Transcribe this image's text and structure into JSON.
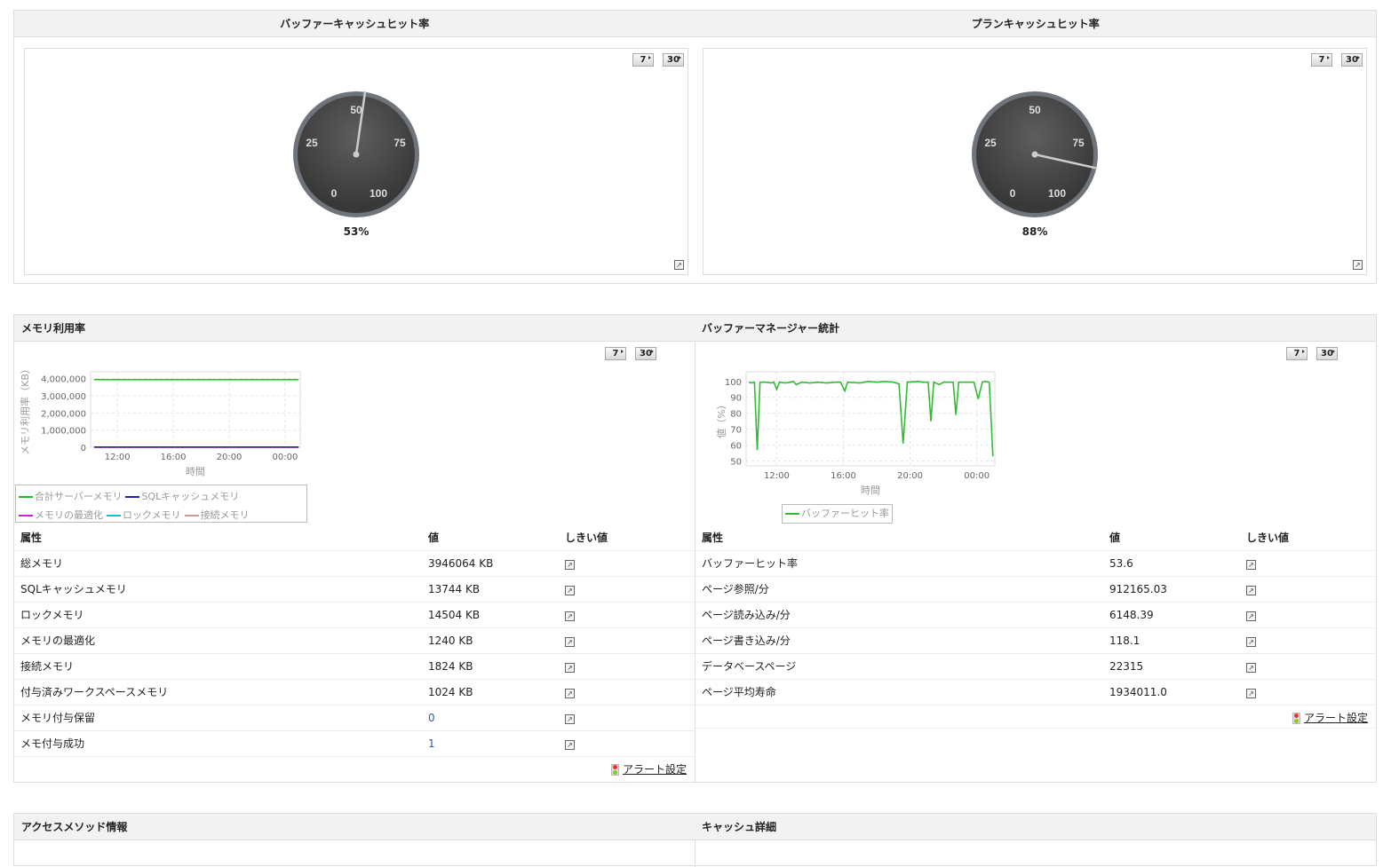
{
  "top_panel": {
    "gauges": [
      {
        "title": "バッファーキャッシュヒット率",
        "value": 53,
        "value_label": "53%",
        "ticks": [
          "0",
          "25",
          "50",
          "75",
          "100"
        ],
        "btn7": "7",
        "btn30": "30"
      },
      {
        "title": "プランキャッシュヒット率",
        "value": 88,
        "value_label": "88%",
        "ticks": [
          "0",
          "25",
          "50",
          "75",
          "100"
        ],
        "btn7": "7",
        "btn30": "30"
      }
    ]
  },
  "memory": {
    "title": "メモリ利用率",
    "btn7": "7",
    "btn30": "30",
    "chart_data": {
      "type": "line",
      "xlabel": "時間",
      "ylabel": "メモリ利用率（KB）",
      "ylim": [
        0,
        4400000
      ],
      "xticks": [
        "12:00",
        "16:00",
        "20:00",
        "00:00"
      ],
      "yticks": [
        "0",
        "1,000,000",
        "2,000,000",
        "3,000,000",
        "4,000,000"
      ],
      "x": [
        "10:20",
        "00:58"
      ],
      "series": [
        {
          "name": "合計サーバーメモリ",
          "color": "#22bb22",
          "values": [
            3946064,
            3946064
          ]
        },
        {
          "name": "SQLキャッシュメモリ",
          "color": "#2222aa",
          "values": [
            13744,
            13744
          ]
        },
        {
          "name": "メモリの最適化",
          "color": "#cc22cc",
          "values": [
            1240,
            1240
          ]
        },
        {
          "name": "ロックメモリ",
          "color": "#22bbcc",
          "values": [
            14504,
            14504
          ]
        },
        {
          "name": "接続メモリ",
          "color": "#cc9999",
          "values": [
            1824,
            1824
          ]
        }
      ]
    },
    "table": {
      "headers": [
        "属性",
        "値",
        "しきい値"
      ],
      "rows": [
        [
          "総メモリ",
          "3946064 KB"
        ],
        [
          "SQLキャッシュメモリ",
          "13744 KB"
        ],
        [
          "ロックメモリ",
          "14504 KB"
        ],
        [
          "メモリの最適化",
          "1240 KB"
        ],
        [
          "接続メモリ",
          "1824 KB"
        ],
        [
          "付与済みワークスペースメモリ",
          "1024 KB"
        ],
        [
          "メモリ付与保留",
          "0"
        ],
        [
          "メモ付与成功",
          "1"
        ]
      ]
    },
    "alert_label": "アラート設定"
  },
  "buffer": {
    "title": "バッファーマネージャー統計",
    "btn7": "7",
    "btn30": "30",
    "chart_data": {
      "type": "line",
      "xlabel": "時間",
      "ylabel": "値（%）",
      "ylim": [
        47,
        106
      ],
      "xticks": [
        "12:00",
        "16:00",
        "20:00",
        "00:00"
      ],
      "yticks": [
        "50",
        "60",
        "70",
        "80",
        "90",
        "100"
      ],
      "series": [
        {
          "name": "バッファーヒット率",
          "color": "#33bb33",
          "points": [
            [
              "10:20",
              99.5
            ],
            [
              "10:30",
              99
            ],
            [
              "10:40",
              99.5
            ],
            [
              "10:50",
              57
            ],
            [
              "11:00",
              99.5
            ],
            [
              "11:20",
              99.5
            ],
            [
              "11:40",
              99
            ],
            [
              "11:50",
              99.5
            ],
            [
              "12:00",
              95
            ],
            [
              "12:10",
              99.5
            ],
            [
              "12:30",
              99
            ],
            [
              "12:50",
              99.5
            ],
            [
              "13:00",
              100
            ],
            [
              "13:10",
              98
            ],
            [
              "13:30",
              99.5
            ],
            [
              "14:00",
              99
            ],
            [
              "14:30",
              99.5
            ],
            [
              "15:00",
              99
            ],
            [
              "15:30",
              99.5
            ],
            [
              "15:50",
              99.5
            ],
            [
              "16:05",
              94
            ],
            [
              "16:15",
              99.5
            ],
            [
              "17:00",
              99
            ],
            [
              "17:30",
              100
            ],
            [
              "18:00",
              99.5
            ],
            [
              "18:30",
              100
            ],
            [
              "19:00",
              99.5
            ],
            [
              "19:20",
              98.5
            ],
            [
              "19:35",
              61
            ],
            [
              "19:50",
              99.5
            ],
            [
              "20:30",
              100
            ],
            [
              "20:45",
              99.5
            ],
            [
              "21:05",
              99.5
            ],
            [
              "21:15",
              75
            ],
            [
              "21:25",
              99.5
            ],
            [
              "21:45",
              98
            ],
            [
              "22:00",
              99.5
            ],
            [
              "22:35",
              99.5
            ],
            [
              "22:45",
              79
            ],
            [
              "22:55",
              99.5
            ],
            [
              "23:50",
              99.5
            ],
            [
              "00:05",
              89
            ],
            [
              "00:20",
              99.5
            ],
            [
              "00:30",
              100
            ],
            [
              "00:45",
              99.5
            ],
            [
              "00:58",
              53
            ]
          ]
        }
      ]
    },
    "table": {
      "headers": [
        "属性",
        "値",
        "しきい値"
      ],
      "rows": [
        [
          "バッファーヒット率",
          "53.6"
        ],
        [
          "ページ参照/分",
          "912165.03"
        ],
        [
          "ページ読み込み/分",
          "6148.39"
        ],
        [
          "ページ書き込み/分",
          "118.1"
        ],
        [
          "データベースページ",
          "22315"
        ],
        [
          "ページ平均寿命",
          "1934011.0"
        ]
      ]
    },
    "alert_label": "アラート設定"
  },
  "bottom": {
    "left_title": "アクセスメソッド情報",
    "right_title": "キャッシュ詳細"
  }
}
